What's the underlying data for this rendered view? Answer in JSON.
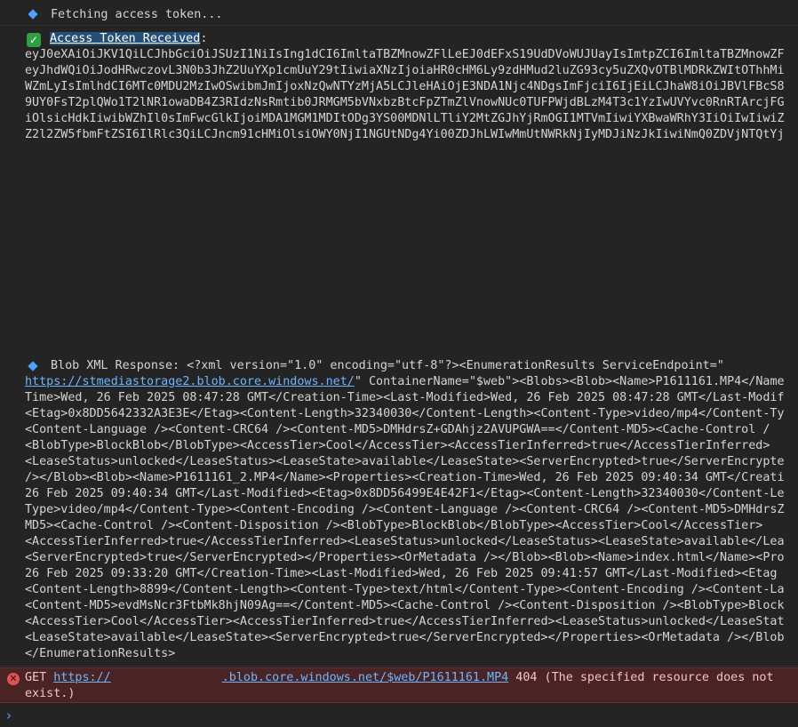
{
  "messages": {
    "fetching": "Fetching access token...",
    "token_label": "Access Token Received",
    "token_colon": ":",
    "token_lines": [
      "eyJ0eXAiOiJKV1QiLCJhbGciOiJSUzI1NiIsIng1dCI6ImltaTBZMnowZFlLeEJ0dEFxS19UdDVoWUJUayIsImtpZCI6ImltaTBZMnowZF",
      "eyJhdWQiOiJodHRwczovL3N0b3JhZ2UuYXp1cmUuY29tIiwiaXNzIjoiaHR0cHM6Ly9zdHMud2luZG93cy5uZXQvOTBlMDRkZWItOThhMi",
      "WZmLyIsImlhdCI6MTc0MDU2MzIwOSwibmJmIjoxNzQwNTYzMjA5LCJleHAiOjE3NDA1Njc4NDgsImFjciI6IjEiLCJhaW8iOiJBVlFBcS8",
      "9UY0FsT2plQWo1T2lNR1owaDB4Z3RIdzNsRmtib0JRMGM5bVNxbzBtcFpZTmZlVnowNUc0TUFPWjdBLzM4T3c1YzIwUVYvc0RnRTArcjFG",
      "iOlsicHdkIiwibWZhIl0sImFwcGlkIjoiMDA1MGM1MDItODg3YS00MDNlLTliY2MtZGJhYjRmOGI1MTVmIiwiYXBwaWRhY3IiOiIwIiwiZ",
      "Z2l2ZW5fbmFtZSI6IlRlc3QiLCJncm91cHMiOlsiOWY0NjI1NGUtNDg4Yi00ZDJhLWIwMmUtNWRkNjIyMDJiNzJkIiwiNmQ0ZDVjNTQtYj"
    ],
    "blob_label": "Blob XML Response: <?xml version=\"1.0\" encoding=\"utf-8\"?><EnumerationResults ServiceEndpoint=\"",
    "blob_url": "https://stmediastorage2.blob.core.windows.net/",
    "blob_after_url": "\" ContainerName=\"$web\"><Blobs><Blob><Name>P1611161.MP4</Name",
    "blob_lines": [
      "Time>Wed, 26 Feb 2025 08:47:28 GMT</Creation-Time><Last-Modified>Wed, 26 Feb 2025 08:47:28 GMT</Last-Modif",
      "<Etag>0x8DD5642332A3E3E</Etag><Content-Length>32340030</Content-Length><Content-Type>video/mp4</Content-Ty",
      "<Content-Language /><Content-CRC64 /><Content-MD5>DMHdrsZ+GDAhjz2AVUPGWA==</Content-MD5><Cache-Control /",
      "<BlobType>BlockBlob</BlobType><AccessTier>Cool</AccessTier><AccessTierInferred>true</AccessTierInferred>",
      "<LeaseStatus>unlocked</LeaseStatus><LeaseState>available</LeaseState><ServerEncrypted>true</ServerEncrypte",
      "/></Blob><Blob><Name>P1611161_2.MP4</Name><Properties><Creation-Time>Wed, 26 Feb 2025 09:40:34 GMT</Creati",
      "26 Feb 2025 09:40:34 GMT</Last-Modified><Etag>0x8DD56499E4E42F1</Etag><Content-Length>32340030</Content-Le",
      "Type>video/mp4</Content-Type><Content-Encoding /><Content-Language /><Content-CRC64 /><Content-MD5>DMHdrsZ",
      "MD5><Cache-Control /><Content-Disposition /><BlobType>BlockBlob</BlobType><AccessTier>Cool</AccessTier>",
      "<AccessTierInferred>true</AccessTierInferred><LeaseStatus>unlocked</LeaseStatus><LeaseState>available</Lea",
      "<ServerEncrypted>true</ServerEncrypted></Properties><OrMetadata /></Blob><Blob><Name>index.html</Name><Pro",
      "26 Feb 2025 09:33:20 GMT</Creation-Time><Last-Modified>Wed, 26 Feb 2025 09:41:57 GMT</Last-Modified><Etag",
      "<Content-Length>8899</Content-Length><Content-Type>text/html</Content-Type><Content-Encoding /><Content-La",
      "<Content-MD5>evdMsNcr3FtbMk8hjN09Ag==</Content-MD5><Cache-Control /><Content-Disposition /><BlobType>Block",
      "<AccessTier>Cool</AccessTier><AccessTierInferred>true</AccessTierInferred><LeaseStatus>unlocked</LeaseStat",
      "<LeaseState>available</LeaseState><ServerEncrypted>true</ServerEncrypted></Properties><OrMetadata /></Blob",
      "</EnumerationResults>"
    ]
  },
  "error": {
    "method": "GET",
    "url_start": "https://",
    "url_end": ".blob.core.windows.net/$web/P1611161.MP4",
    "status": "404 (The specified resource does not",
    "status_cont": "exist.)"
  },
  "colors": {
    "background": "#242424",
    "info": "#4aa3ff",
    "success": "#2ea043",
    "error_bg": "#4a2424",
    "link": "#6cb6ff"
  },
  "icons": {
    "info": "diamond-icon",
    "success": "checkmark-icon",
    "error": "error-circle-icon",
    "prompt": "chevron-right-icon"
  }
}
